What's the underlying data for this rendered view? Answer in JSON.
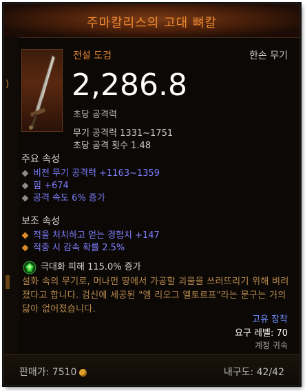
{
  "item": {
    "name": "주마칼리스의 고대 뼈칼",
    "rarity": "전설 도검",
    "slot": "한손 무기",
    "dps": "2,286.8",
    "dps_label": "초당 공격력",
    "weapon_damage": "무기 공격력 1331~1751",
    "attack_speed": "초당 공격 횟수 1.48"
  },
  "primary": {
    "title": "주요 속성",
    "props": [
      "비전 무기 공격력 +1163~1359",
      "힘 +674",
      "공격 속도 6% 증가"
    ]
  },
  "secondary": {
    "title": "보조 속성",
    "props": [
      "적을 처치하고 얻는 경험치 +147",
      "적중 시 감속 확률 2.5%"
    ]
  },
  "legendary_gem": {
    "text": "극대화 피해 115.0% 증가",
    "icon": "emerald-gem-icon"
  },
  "flavor": "설화 속의 무기로, 머나먼 땅에서 가공할 괴물을 쓰러뜨리기 위해 벼려졌다고 합니다. 검신에 세공된 \"엠 리오그 엘토르프\"라는 문구는 거의 닳아 없어졌습니다.",
  "footer": {
    "unique": "고유 장착",
    "required_level": "요구 레벨: 70",
    "bound": "계정 귀속",
    "price": "판매가: 7510",
    "durability": "내구도: 42/42"
  },
  "colors": {
    "legendary_orange": "#f08a32",
    "magic_blue": "#7f7fff",
    "flavor_gold": "#b88a4e"
  }
}
